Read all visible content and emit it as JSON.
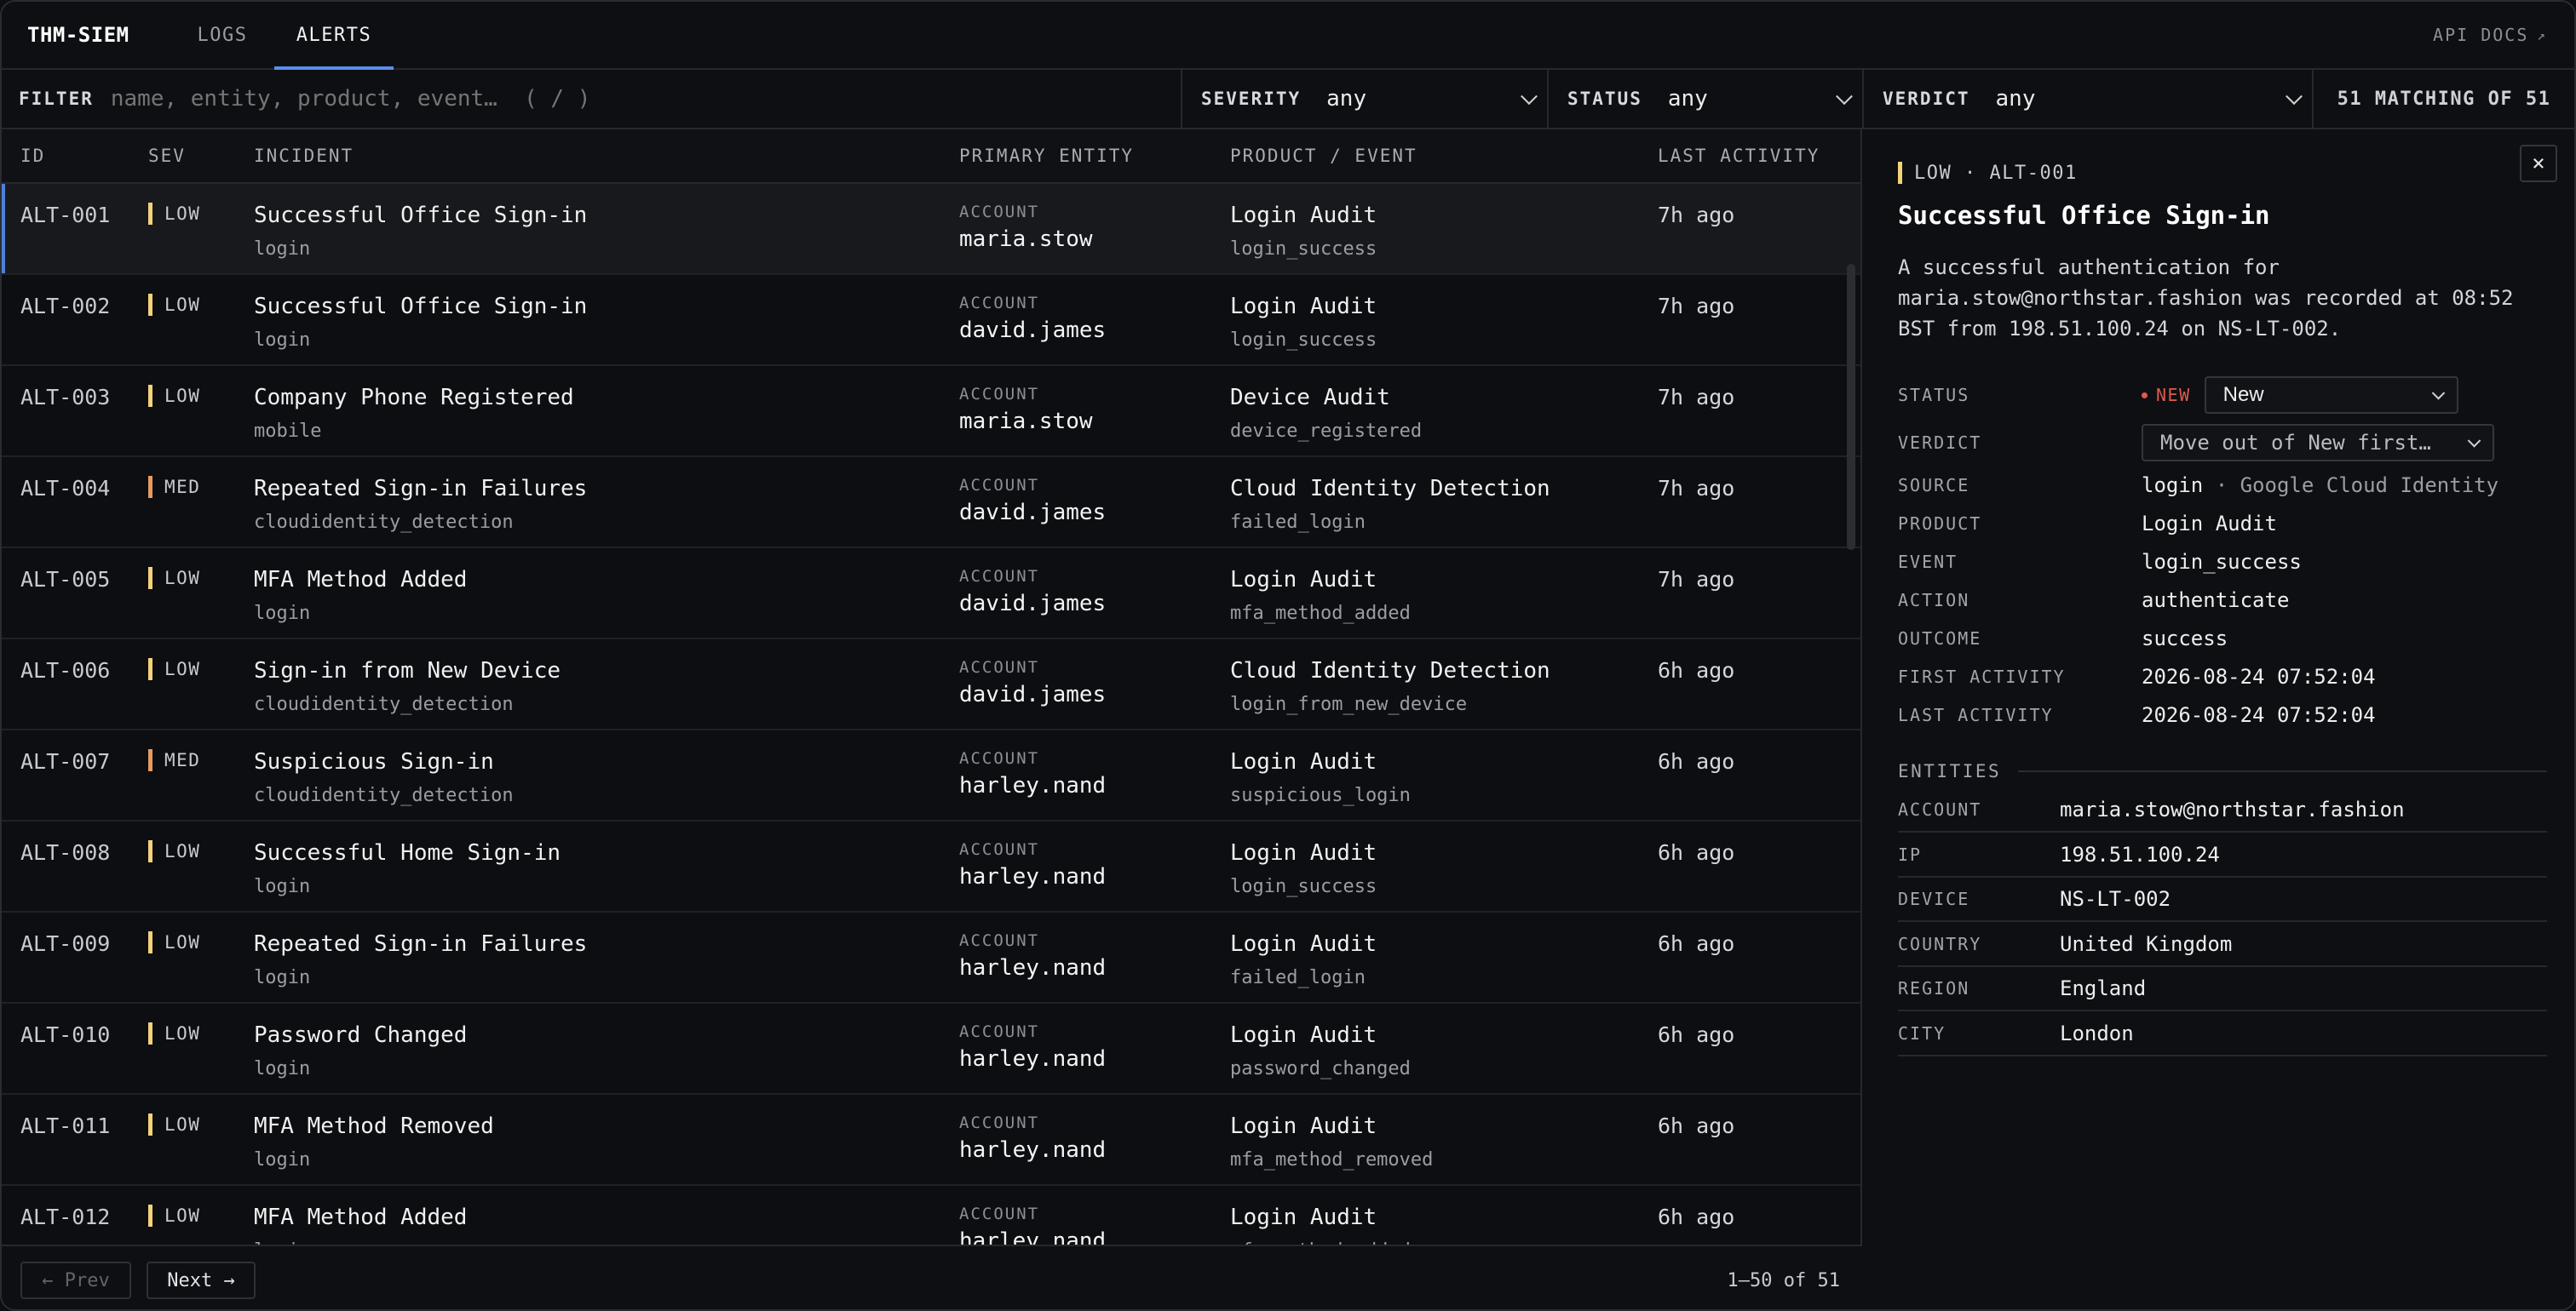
{
  "app": {
    "brand": "THM-SIEM",
    "tabs": [
      "LOGS",
      "ALERTS"
    ],
    "active_tab": "ALERTS",
    "api_docs": "API DOCS",
    "api_docs_icon": "↗"
  },
  "filters": {
    "filter_label": "FILTER",
    "filter_placeholder": "name, entity, product, event…  ( / )",
    "severity_label": "SEVERITY",
    "severity_value": "any",
    "status_label": "STATUS",
    "status_value": "any",
    "verdict_label": "VERDICT",
    "verdict_value": "any",
    "match_count": "51 MATCHING OF 51"
  },
  "table": {
    "headers": {
      "id": "ID",
      "sev": "SEV",
      "incident": "INCIDENT",
      "entity": "PRIMARY ENTITY",
      "product": "PRODUCT / EVENT",
      "last": "LAST ACTIVITY"
    },
    "rows": [
      {
        "id": "ALT-001",
        "sev": "LOW",
        "title": "Successful Office Sign-in",
        "source": "login",
        "entity_type": "ACCOUNT",
        "entity": "maria.stow",
        "product": "Login Audit",
        "event": "login_success",
        "last": "7h ago"
      },
      {
        "id": "ALT-002",
        "sev": "LOW",
        "title": "Successful Office Sign-in",
        "source": "login",
        "entity_type": "ACCOUNT",
        "entity": "david.james",
        "product": "Login Audit",
        "event": "login_success",
        "last": "7h ago"
      },
      {
        "id": "ALT-003",
        "sev": "LOW",
        "title": "Company Phone Registered",
        "source": "mobile",
        "entity_type": "ACCOUNT",
        "entity": "maria.stow",
        "product": "Device Audit",
        "event": "device_registered",
        "last": "7h ago"
      },
      {
        "id": "ALT-004",
        "sev": "MED",
        "title": "Repeated Sign-in Failures",
        "source": "cloudidentity_detection",
        "entity_type": "ACCOUNT",
        "entity": "david.james",
        "product": "Cloud Identity Detection",
        "event": "failed_login",
        "last": "7h ago"
      },
      {
        "id": "ALT-005",
        "sev": "LOW",
        "title": "MFA Method Added",
        "source": "login",
        "entity_type": "ACCOUNT",
        "entity": "david.james",
        "product": "Login Audit",
        "event": "mfa_method_added",
        "last": "7h ago"
      },
      {
        "id": "ALT-006",
        "sev": "LOW",
        "title": "Sign-in from New Device",
        "source": "cloudidentity_detection",
        "entity_type": "ACCOUNT",
        "entity": "david.james",
        "product": "Cloud Identity Detection",
        "event": "login_from_new_device",
        "last": "6h ago"
      },
      {
        "id": "ALT-007",
        "sev": "MED",
        "title": "Suspicious Sign-in",
        "source": "cloudidentity_detection",
        "entity_type": "ACCOUNT",
        "entity": "harley.nand",
        "product": "Login Audit",
        "event": "suspicious_login",
        "last": "6h ago"
      },
      {
        "id": "ALT-008",
        "sev": "LOW",
        "title": "Successful Home Sign-in",
        "source": "login",
        "entity_type": "ACCOUNT",
        "entity": "harley.nand",
        "product": "Login Audit",
        "event": "login_success",
        "last": "6h ago"
      },
      {
        "id": "ALT-009",
        "sev": "LOW",
        "title": "Repeated Sign-in Failures",
        "source": "login",
        "entity_type": "ACCOUNT",
        "entity": "harley.nand",
        "product": "Login Audit",
        "event": "failed_login",
        "last": "6h ago"
      },
      {
        "id": "ALT-010",
        "sev": "LOW",
        "title": "Password Changed",
        "source": "login",
        "entity_type": "ACCOUNT",
        "entity": "harley.nand",
        "product": "Login Audit",
        "event": "password_changed",
        "last": "6h ago"
      },
      {
        "id": "ALT-011",
        "sev": "LOW",
        "title": "MFA Method Removed",
        "source": "login",
        "entity_type": "ACCOUNT",
        "entity": "harley.nand",
        "product": "Login Audit",
        "event": "mfa_method_removed",
        "last": "6h ago"
      },
      {
        "id": "ALT-012",
        "sev": "LOW",
        "title": "MFA Method Added",
        "source": "login",
        "entity_type": "ACCOUNT",
        "entity": "harley.nand",
        "product": "Login Audit",
        "event": "mfa_method_added",
        "last": "6h ago"
      }
    ]
  },
  "pagination": {
    "prev": "← Prev",
    "next": "Next →",
    "range": "1–50 of 51"
  },
  "detail": {
    "close": "×",
    "sev": "LOW",
    "id": "ALT-001",
    "title": "Successful Office Sign-in",
    "description": "A successful authentication for maria.stow@northstar.fashion was recorded at 08:52 BST from 198.51.100.24 on NS-LT-002.",
    "status_label": "STATUS",
    "status_badge": "NEW",
    "status_select": "New",
    "verdict_label": "VERDICT",
    "verdict_select": "Move out of New first…",
    "source_label": "SOURCE",
    "source_value": "login",
    "source_sep": "·",
    "source_provider": "Google Cloud Identity",
    "product_label": "PRODUCT",
    "product_value": "Login Audit",
    "event_label": "EVENT",
    "event_value": "login_success",
    "action_label": "ACTION",
    "action_value": "authenticate",
    "outcome_label": "OUTCOME",
    "outcome_value": "success",
    "first_label": "FIRST ACTIVITY",
    "first_value": "2026-08-24 07:52:04",
    "last_label": "LAST ACTIVITY",
    "last_value": "2026-08-24 07:52:04",
    "entities_heading": "ENTITIES",
    "entities": [
      {
        "k": "ACCOUNT",
        "v": "maria.stow@northstar.fashion"
      },
      {
        "k": "IP",
        "v": "198.51.100.24"
      },
      {
        "k": "DEVICE",
        "v": "NS-LT-002"
      },
      {
        "k": "COUNTRY",
        "v": "United Kingdom"
      },
      {
        "k": "REGION",
        "v": "England"
      },
      {
        "k": "CITY",
        "v": "London"
      }
    ]
  },
  "colors": {
    "accent": "#5b8ff0",
    "sev_low": "#f3d27a",
    "sev_med": "#e89a63",
    "new_badge": "#e05a4f"
  }
}
